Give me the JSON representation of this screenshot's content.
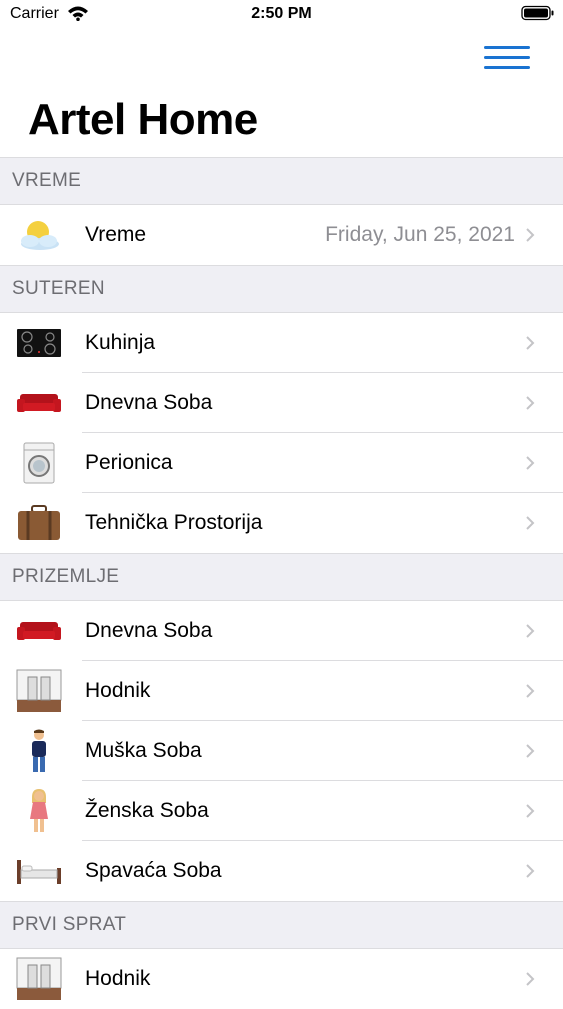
{
  "status_bar": {
    "carrier": "Carrier",
    "time": "2:50 PM"
  },
  "nav": {
    "title": "Artel Home"
  },
  "accent_color": "#1a73d1",
  "sections": [
    {
      "header": "VREME",
      "rows": [
        {
          "icon": "sun-cloud-icon",
          "label": "Vreme",
          "detail": "Friday, Jun 25, 2021"
        }
      ]
    },
    {
      "header": "SUTEREN",
      "rows": [
        {
          "icon": "stove-icon",
          "label": "Kuhinja"
        },
        {
          "icon": "sofa-icon",
          "label": "Dnevna Soba"
        },
        {
          "icon": "washing-machine-icon",
          "label": "Perionica"
        },
        {
          "icon": "suitcase-icon",
          "label": "Tehnička Prostorija"
        }
      ]
    },
    {
      "header": "PRIZEMLJE",
      "rows": [
        {
          "icon": "sofa-icon",
          "label": "Dnevna Soba"
        },
        {
          "icon": "hallway-icon",
          "label": "Hodnik"
        },
        {
          "icon": "man-icon",
          "label": "Muška Soba"
        },
        {
          "icon": "woman-icon",
          "label": "Ženska Soba"
        },
        {
          "icon": "bed-icon",
          "label": "Spavaća Soba"
        }
      ]
    },
    {
      "header": "PRVI SPRAT",
      "rows": [
        {
          "icon": "hallway-icon",
          "label": "Hodnik"
        }
      ]
    }
  ]
}
